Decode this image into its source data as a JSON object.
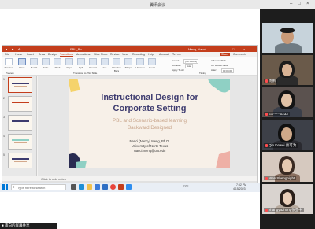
{
  "meeting": {
    "title": "腾讯会议",
    "sharing_label": "■ 南向的屏幕共享",
    "participants": [
      {
        "name": ""
      },
      {
        "name": "杨鹏"
      },
      {
        "name": "ES*****0233"
      },
      {
        "name": "Qin Kewei 秦可为"
      },
      {
        "name": "Wen Shengnight"
      },
      {
        "name": "zhangyazhong张亚中"
      }
    ]
  },
  "ppt": {
    "window_title": "PBL_Bo...",
    "user": "Meng, Nanci",
    "tabs": [
      "File",
      "Home",
      "Insert",
      "Draw",
      "Design",
      "Transitions",
      "Animations",
      "Slide Show",
      "Review",
      "View",
      "Recording",
      "Help",
      "Acrobat",
      "Tell me"
    ],
    "active_tab": "Transitions",
    "share_label": "Share",
    "comments_label": "Comments",
    "transitions": [
      "Preview",
      "None",
      "Morph",
      "Fade",
      "Push",
      "Wipe",
      "Split",
      "Reveal",
      "Cut",
      "Random Bars",
      "Shape",
      "Uncover",
      "Cover"
    ],
    "timing": {
      "sound_label": "Sound:",
      "sound_value": "[No Sound]",
      "duration_label": "Duration:",
      "duration_value": "Auto",
      "apply_all": "Apply To All",
      "advance_label": "Advance Slide",
      "on_mouse_click": "On Mouse Click",
      "after_label": "After:",
      "after_value": "00:00.00"
    },
    "group_labels": {
      "preview": "Preview",
      "transition": "Transition to This Slide",
      "timing": "Timing"
    },
    "slide_numbers": [
      "1",
      "2",
      "3",
      "4",
      "5"
    ],
    "notes_placeholder": "Click to add notes",
    "slide": {
      "title_line1": "Instructional Design for",
      "title_line2": "Corporate Setting",
      "subtitle_line1": "PBL and Scenario-based learning",
      "subtitle_line2": "Backward Designed",
      "author": "Nanci (Nancy) Meng, Ph.D.",
      "affiliation": "University of North Texas",
      "email": "Nanci.meng@unt.edu"
    }
  },
  "taskbar": {
    "search_placeholder": "Type here to search",
    "weather": "72°F",
    "time": "7:52 PM",
    "date": "4/15/2023"
  },
  "colors": {
    "ppt_red": "#c43e1c",
    "slide_title": "#3d3b6f",
    "slide_subtitle": "#c8a48a",
    "slide_bg": "#f7f0e8",
    "accent_yellow": "#f5d36b",
    "accent_teal": "#8fd0c4",
    "accent_navy": "#2a2c52",
    "accent_pink": "#eeb0a6"
  },
  "icons": [
    "windows-start-icon",
    "search-icon",
    "task-view-icon",
    "edge-icon",
    "file-explorer-icon",
    "store-icon",
    "mail-icon",
    "chrome-icon",
    "powerpoint-icon",
    "tencent-meeting-icon",
    "mic-muted-icon"
  ]
}
